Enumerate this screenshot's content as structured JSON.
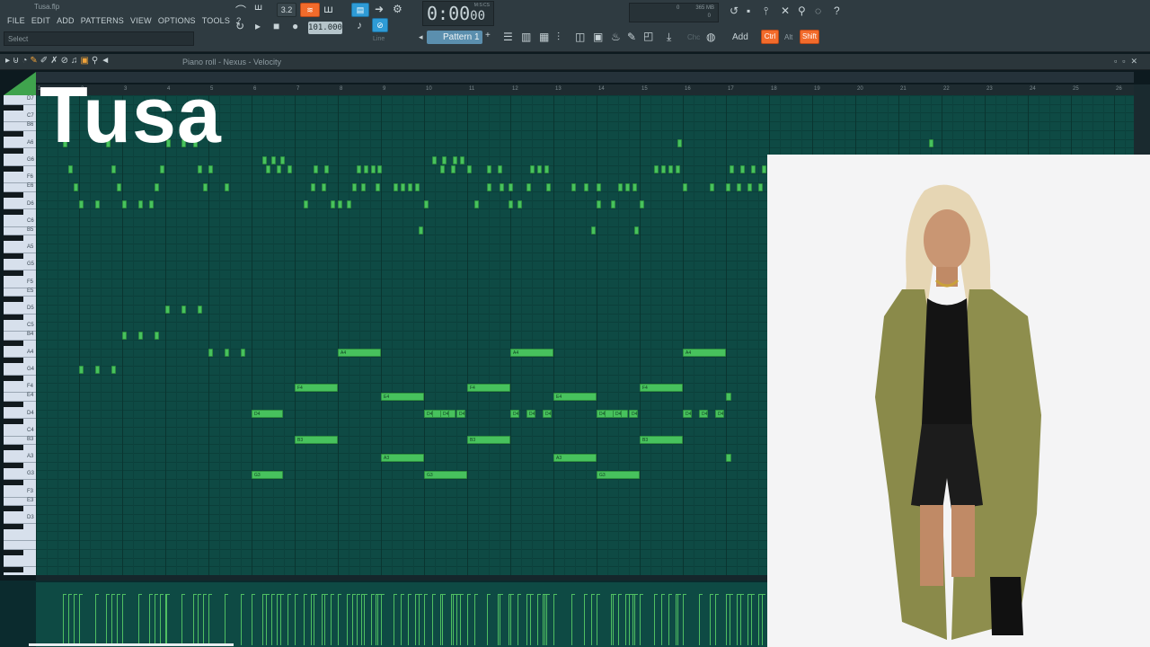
{
  "window": {
    "file_title": "Tusa.flp",
    "hint": "Select"
  },
  "menu": [
    "FILE",
    "EDIT",
    "ADD",
    "PATTERNS",
    "VIEW",
    "OPTIONS",
    "TOOLS",
    "?"
  ],
  "transport": {
    "time": "0:00",
    "time_sub": "00",
    "time_unit": "M:S:CS",
    "tempo": "101.000",
    "step": "3.2",
    "snap": "Line",
    "pattern": "Pattern 1"
  },
  "memory": {
    "mb": "365 MB",
    "val1": "0",
    "val2": "0"
  },
  "shortcuts": {
    "add": "Add",
    "ctrl": "Ctrl",
    "alt": "Alt",
    "shift": "Shift",
    "channel": "Chc"
  },
  "piano_roll": {
    "title": "Piano roll - Nexus - Velocity"
  },
  "ruler_numbers": [
    "1",
    "2",
    "3",
    "4",
    "5",
    "6",
    "7",
    "8",
    "9",
    "10",
    "11",
    "12",
    "13",
    "14",
    "15",
    "16",
    "17",
    "18",
    "19",
    "20",
    "21",
    "22",
    "23",
    "24",
    "25",
    "26"
  ],
  "keys": [
    "D7",
    "C7",
    "B6",
    "A6",
    "G6",
    "F6",
    "E6",
    "D6",
    "C6",
    "B5",
    "A5",
    "G5",
    "F5",
    "E5",
    "D5",
    "C5",
    "B4",
    "A4",
    "G4",
    "F4",
    "E4",
    "D4",
    "C4",
    "B3",
    "A3",
    "G3",
    "F3",
    "E3",
    "D3"
  ],
  "overlay": {
    "song_title": "Tusa"
  },
  "notes": [
    {
      "pitch": "A4",
      "label": "A4"
    },
    {
      "pitch": "F4",
      "label": "F4"
    },
    {
      "pitch": "E4",
      "label": "E4"
    },
    {
      "pitch": "D4",
      "label": "D4"
    },
    {
      "pitch": "B3",
      "label": "B3"
    },
    {
      "pitch": "A3",
      "label": "A3"
    },
    {
      "pitch": "G3",
      "label": "G3"
    }
  ],
  "colors": {
    "grid": "#0e4a44",
    "note": "#47c25d",
    "toolbar": "#2f3b41",
    "accent_orange": "#f26b2b",
    "accent_blue": "#2e9bd6"
  }
}
